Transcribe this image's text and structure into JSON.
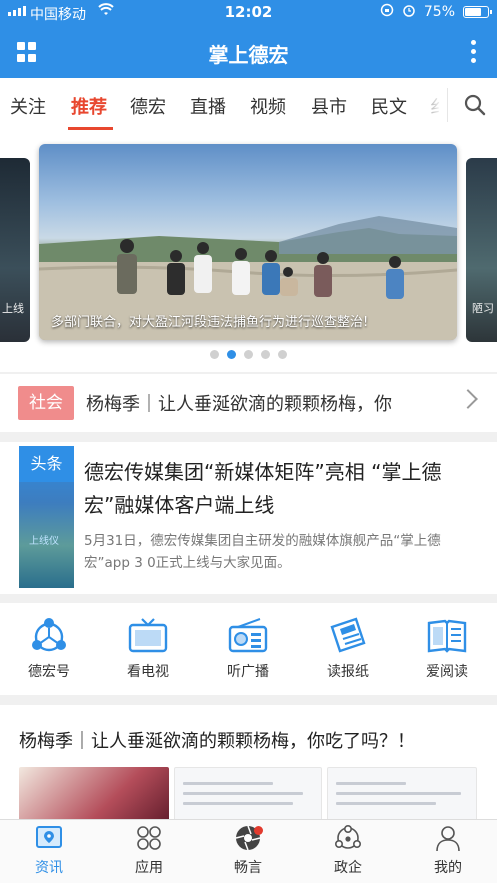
{
  "status_bar": {
    "carrier": "中国移动",
    "time": "12:02",
    "battery": "75%",
    "battery_level": 0.75
  },
  "header": {
    "title": "掌上德宏"
  },
  "tabs": [
    {
      "label": "关注"
    },
    {
      "label": "推荐",
      "active": true
    },
    {
      "label": "德宏"
    },
    {
      "label": "直播"
    },
    {
      "label": "视频"
    },
    {
      "label": "县市"
    },
    {
      "label": "民文"
    },
    {
      "label": "纟"
    }
  ],
  "carousel": {
    "caption": "多部门联合，对大盈江河段违法捕鱼行为进行巡查整治!",
    "left_peek_text": "上线",
    "right_peek_text": "陋习",
    "page_count": 5,
    "active_index": 1
  },
  "ticker": {
    "tag": "社会",
    "text": "杨梅季｜让人垂涎欲滴的颗颗杨梅，你"
  },
  "headline": {
    "tag": "头条",
    "thumb_text": "上线仪",
    "title": "德宏传媒集团“新媒体矩阵”亮相 “掌上德宏”融媒体客户端上线",
    "summary": "5月31日，德宏传媒集团自主研发的融媒体旗舰产品“掌上德宏”app 3 0正式上线与大家见面。"
  },
  "services": [
    {
      "label": "德宏号",
      "icon": "share-network-icon"
    },
    {
      "label": "看电视",
      "icon": "tv-icon"
    },
    {
      "label": "听广播",
      "icon": "radio-icon"
    },
    {
      "label": "读报纸",
      "icon": "newspaper-icon"
    },
    {
      "label": "爱阅读",
      "icon": "book-icon"
    }
  ],
  "article": {
    "title": "杨梅季｜让人垂涎欲滴的颗颗杨梅，你吃了吗？！"
  },
  "bottom_nav": [
    {
      "label": "资讯",
      "icon": "news-location-icon",
      "active": true
    },
    {
      "label": "应用",
      "icon": "apps-icon"
    },
    {
      "label": "畅言",
      "icon": "camera-aperture-icon",
      "badge": true
    },
    {
      "label": "政企",
      "icon": "government-network-icon"
    },
    {
      "label": "我的",
      "icon": "person-icon"
    }
  ],
  "colors": {
    "brand_blue": "#2f8fe6",
    "active_red": "#e8472f",
    "tag_pink": "#f08c8c"
  }
}
